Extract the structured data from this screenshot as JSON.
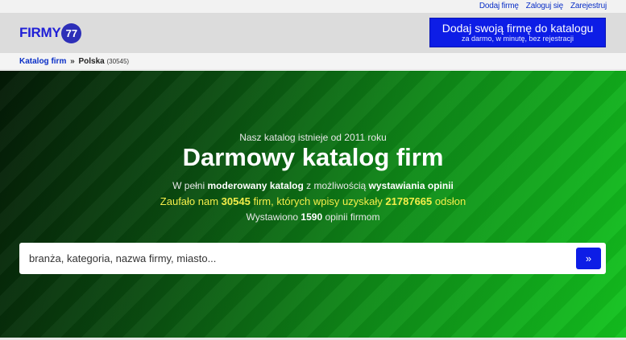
{
  "toplinks": {
    "add_firm": "Dodaj firmę",
    "login": "Zaloguj się",
    "register": "Zarejestruj"
  },
  "logo": {
    "text": "FIRMY",
    "number": "77"
  },
  "cta": {
    "main": "Dodaj swoją firmę do katalogu",
    "sub": "za darmo, w minutę, bez rejestracji"
  },
  "breadcrumb": {
    "root": "Katalog firm",
    "separator": "»",
    "current": "Polska",
    "count": "(30545)"
  },
  "hero": {
    "since": "Nasz katalog istnieje od 2011 roku",
    "title": "Darmowy katalog firm",
    "line1": {
      "a": "W pełni ",
      "b": "moderowany katalog",
      "c": " z możliwością ",
      "d": "wystawiania opinii"
    },
    "line2": {
      "a": "Zaufało nam ",
      "firms": "30545",
      "b": " firm, których wpisy uzyskały ",
      "views": "21787665",
      "c": " odsłon"
    },
    "line3": {
      "a": "Wystawiono ",
      "opinions": "1590",
      "b": " opinii firmom"
    }
  },
  "search": {
    "placeholder": "branża, kategoria, nazwa firmy, miasto...",
    "button": "»"
  }
}
